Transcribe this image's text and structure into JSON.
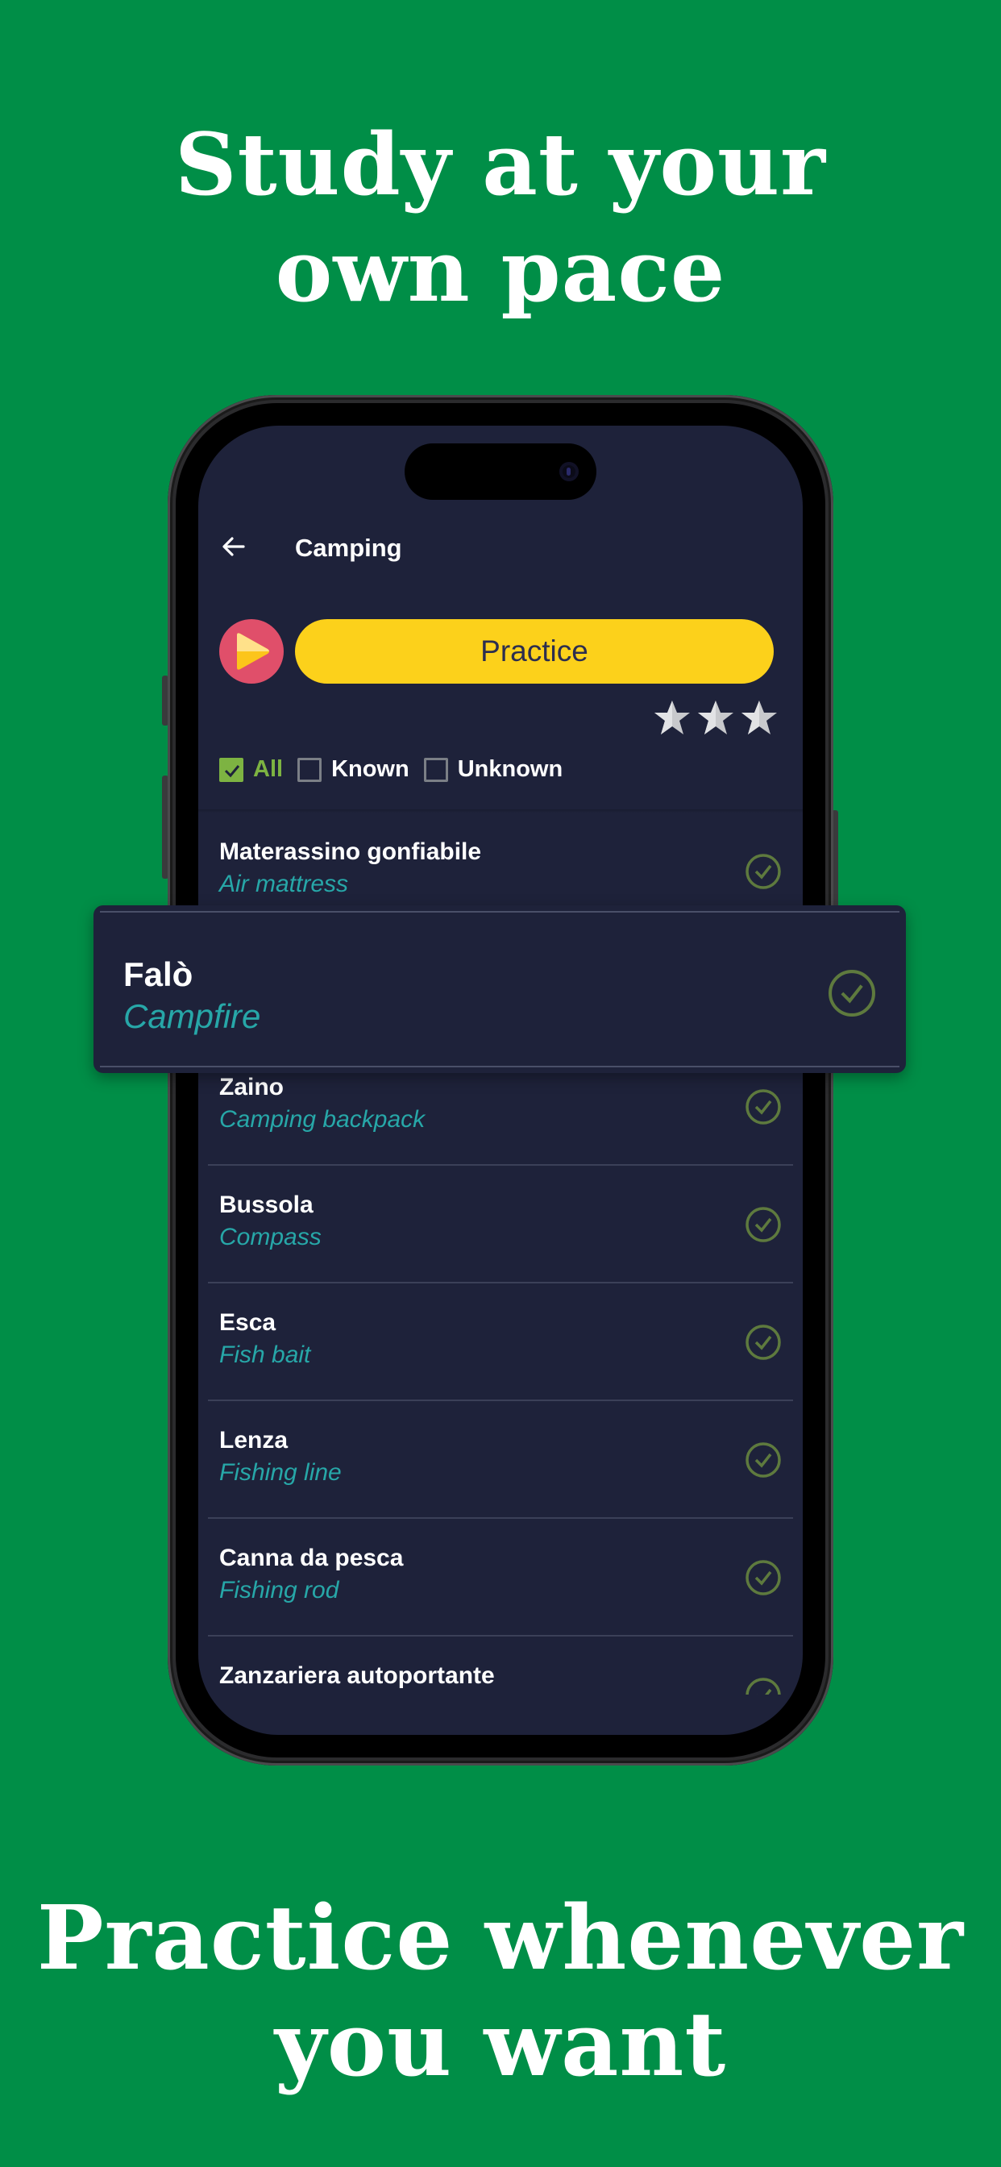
{
  "headline_top": [
    "Study at your",
    "own pace"
  ],
  "headline_bottom": [
    "Practice whenever",
    "you want"
  ],
  "app": {
    "back_icon": "arrow-left-icon",
    "title": "Camping",
    "play_icon": "play-icon",
    "practice_label": "Practice",
    "stars": {
      "filled": 0,
      "total": 3
    },
    "filters": [
      {
        "label": "All",
        "checked": true
      },
      {
        "label": "Known",
        "checked": false
      },
      {
        "label": "Unknown",
        "checked": false
      }
    ]
  },
  "list": [
    {
      "word": "Materassino gonfiabile",
      "translation": "Air mattress",
      "known": true
    },
    {
      "word": "Falò",
      "translation": "Campfire",
      "known": true,
      "highlighted": true
    },
    {
      "word": "Zaino",
      "translation": "Camping backpack",
      "known": true
    },
    {
      "word": "Bussola",
      "translation": "Compass",
      "known": true
    },
    {
      "word": "Esca",
      "translation": "Fish bait",
      "known": true
    },
    {
      "word": "Lenza",
      "translation": "Fishing line",
      "known": true
    },
    {
      "word": "Canna da pesca",
      "translation": "Fishing rod",
      "known": true
    },
    {
      "word": "Zanzariera autoportante",
      "translation": "",
      "known": true
    }
  ],
  "colors": {
    "background": "#008e47",
    "screen": "#1e223a",
    "practice_button": "#fcd11b",
    "play_button": "#e04f6a",
    "accent_green": "#7db342",
    "translation": "#27a7a8",
    "check": "#5e7a3e"
  }
}
